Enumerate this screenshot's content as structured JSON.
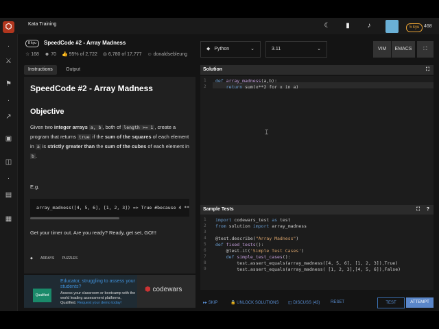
{
  "topbar": {
    "tab": "Kata Training",
    "rank": "5 kyu",
    "honor": "468"
  },
  "kata": {
    "kyu": "8 kyu",
    "title": "SpeedCode #2 - Array Madness",
    "stats": {
      "bookmarks": "168",
      "votes": "70",
      "satisfaction": "95% of 2,722",
      "completed": "6,780 of 17,777",
      "author": "donaldsebleung"
    }
  },
  "tabs": [
    "Instructions",
    "Output"
  ],
  "description": {
    "title": "SpeedCode #2 - Array Madness",
    "objective": "Objective",
    "p1": "Given two ",
    "p1b": "integer arrays",
    "p1c": ", both of ",
    "p1d": ", create a program that returns ",
    "p1e": " if the ",
    "p1f": "sum of the squares",
    "p1g": " of each element in ",
    "p1h": " is ",
    "p1i": "strictly greater than",
    "p1j": " the ",
    "p1k": "sum of the cubes",
    "p1l": " of each element in ",
    "code_ab": "a, b",
    "code_len": "length >= 1",
    "code_true": "true",
    "code_a": "a",
    "code_b": "b",
    "eg": "E.g.",
    "example": "array_madness([4, 5, 6], [1, 2, 3]) => True #because 4 ** 2 + 5 ** 2 + 6 ** 2 > 1 ** 3 + 2 ** 3 + 3 ** 3",
    "timer": "Get your timer out. Are you ready? Ready, get set, GO!!!",
    "tags": [
      "ARRAYS",
      "PUZZLES"
    ]
  },
  "promo": {
    "logo": "Qualified",
    "heading": "Educator, struggling to assess your students?",
    "text": "Assess your classroom or bootcamp with the world leading assessment platforms, Qualified.",
    "link": "Request your demo today!",
    "brand_c": "codewars"
  },
  "language": {
    "name": "Python",
    "version": "3.11"
  },
  "modes": {
    "vim": "VIM",
    "emacs": "EMACS"
  },
  "solution": {
    "title": "Solution",
    "lines": [
      {
        "n": "1",
        "kw": "def ",
        "fn": "array_madness",
        "rest": "(a,b):"
      },
      {
        "n": "2",
        "indent": "    ",
        "kw": "return ",
        "rest": "sum(x**2 for x in a)"
      }
    ]
  },
  "tests": {
    "title": "Sample Tests",
    "lines": [
      {
        "n": "1",
        "kw": "import ",
        "rest": "codewars_test ",
        "kw2": "as ",
        "rest2": "test"
      },
      {
        "n": "2",
        "kw": "from ",
        "rest": "solution ",
        "kw2": "import ",
        "rest2": "array_madness"
      },
      {
        "n": "3",
        "rest": ""
      },
      {
        "n": "4",
        "rest": "@test.describe(",
        "str": "\"Array Madness\"",
        "rest2": ")"
      },
      {
        "n": "5",
        "kw": "def ",
        "fn": "fixed_tests",
        "rest": "():"
      },
      {
        "n": "6",
        "rest": "    @test.it(",
        "str": "'Simple Test Cases'",
        "rest2": ")"
      },
      {
        "n": "7",
        "kw": "    def ",
        "fn": "simple_test_cases",
        "rest": "():"
      },
      {
        "n": "8",
        "rest": "        test.assert_equals(array_madness([4, 5, 6], [1, 2, 3]),True)"
      },
      {
        "n": "9",
        "rest": "        test.assert_equals(array_madness( [1, 2, 3],[4, 5, 6]),False)"
      }
    ]
  },
  "footer": {
    "skip": "SKIP",
    "unlock": "UNLOCK SOLUTIONS",
    "discuss": "DISCUSS (43)",
    "reset": "RESET",
    "test": "TEST",
    "attempt": "ATTEMPT"
  }
}
